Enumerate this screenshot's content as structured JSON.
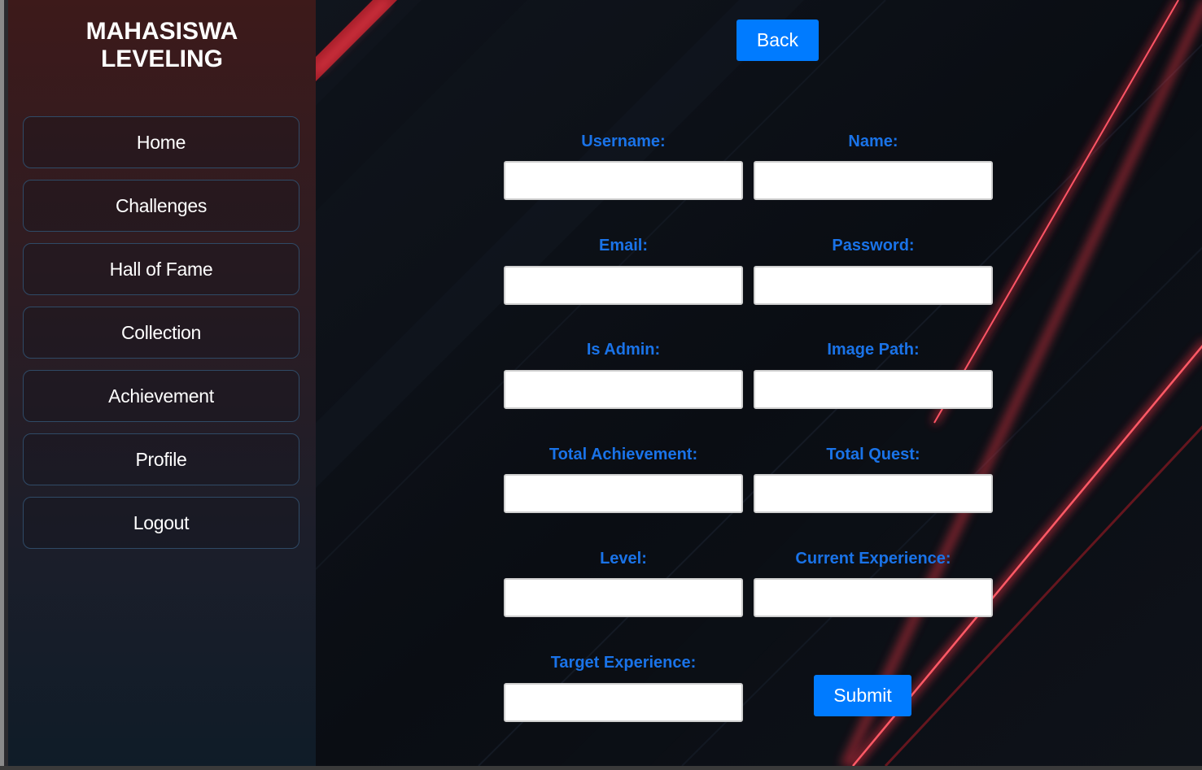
{
  "brand": {
    "line1": "MAHASISWA",
    "line2": "LEVELING"
  },
  "sidebar": {
    "items": [
      {
        "label": "Home"
      },
      {
        "label": "Challenges"
      },
      {
        "label": "Hall of Fame"
      },
      {
        "label": "Collection"
      },
      {
        "label": "Achievement"
      },
      {
        "label": "Profile"
      },
      {
        "label": "Logout"
      }
    ]
  },
  "toolbar": {
    "back_label": "Back"
  },
  "form": {
    "username": {
      "label": "Username:",
      "value": "",
      "placeholder": ""
    },
    "name": {
      "label": "Name:",
      "value": "",
      "placeholder": ""
    },
    "email": {
      "label": "Email:",
      "value": "",
      "placeholder": ""
    },
    "password": {
      "label": "Password:",
      "value": "",
      "placeholder": ""
    },
    "is_admin": {
      "label": "Is Admin:",
      "value": "",
      "placeholder": ""
    },
    "image_path": {
      "label": "Image Path:",
      "value": "",
      "placeholder": ""
    },
    "total_achievement": {
      "label": "Total Achievement:",
      "value": "",
      "placeholder": ""
    },
    "total_quest": {
      "label": "Total Quest:",
      "value": "",
      "placeholder": ""
    },
    "level": {
      "label": "Level:",
      "value": "",
      "placeholder": ""
    },
    "current_experience": {
      "label": "Current Experience:",
      "value": "",
      "placeholder": ""
    },
    "target_experience": {
      "label": "Target Experience:",
      "value": "",
      "placeholder": ""
    },
    "submit_label": "Submit"
  },
  "colors": {
    "accent": "#007bff",
    "label": "#1a73e8",
    "background": "#0a0e15",
    "streak": "#ff3344"
  }
}
